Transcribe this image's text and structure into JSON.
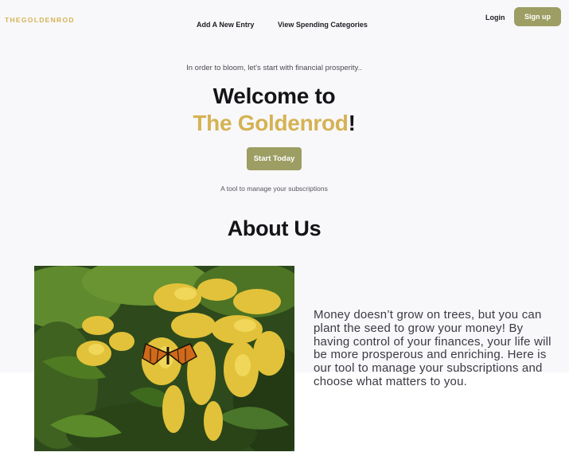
{
  "header": {
    "brand": "THEGOLDENROD",
    "nav": {
      "add_entry": "Add A New Entry",
      "view_categories": "View Spending Categories"
    },
    "login": "Login",
    "signup": "Sign up"
  },
  "hero": {
    "tagline": "In order to bloom, let's start with financial prosperity..",
    "title_line1": "Welcome to",
    "title_brand": "The Goldenrod",
    "title_exclaim": "!",
    "cta": "Start Today",
    "subtext": "A tool to manage your subscriptions"
  },
  "about": {
    "title": "About Us",
    "body": "Money doesn’t grow on trees, but you can plant the seed to grow your money! By having control of your finances, your life will be more prosperous and enriching. Here is our tool to manage your subscriptions and choose what matters to you."
  },
  "colors": {
    "accent_gold": "#d5b254",
    "button_olive": "#9c9e63",
    "background": "#f8f8fa"
  }
}
